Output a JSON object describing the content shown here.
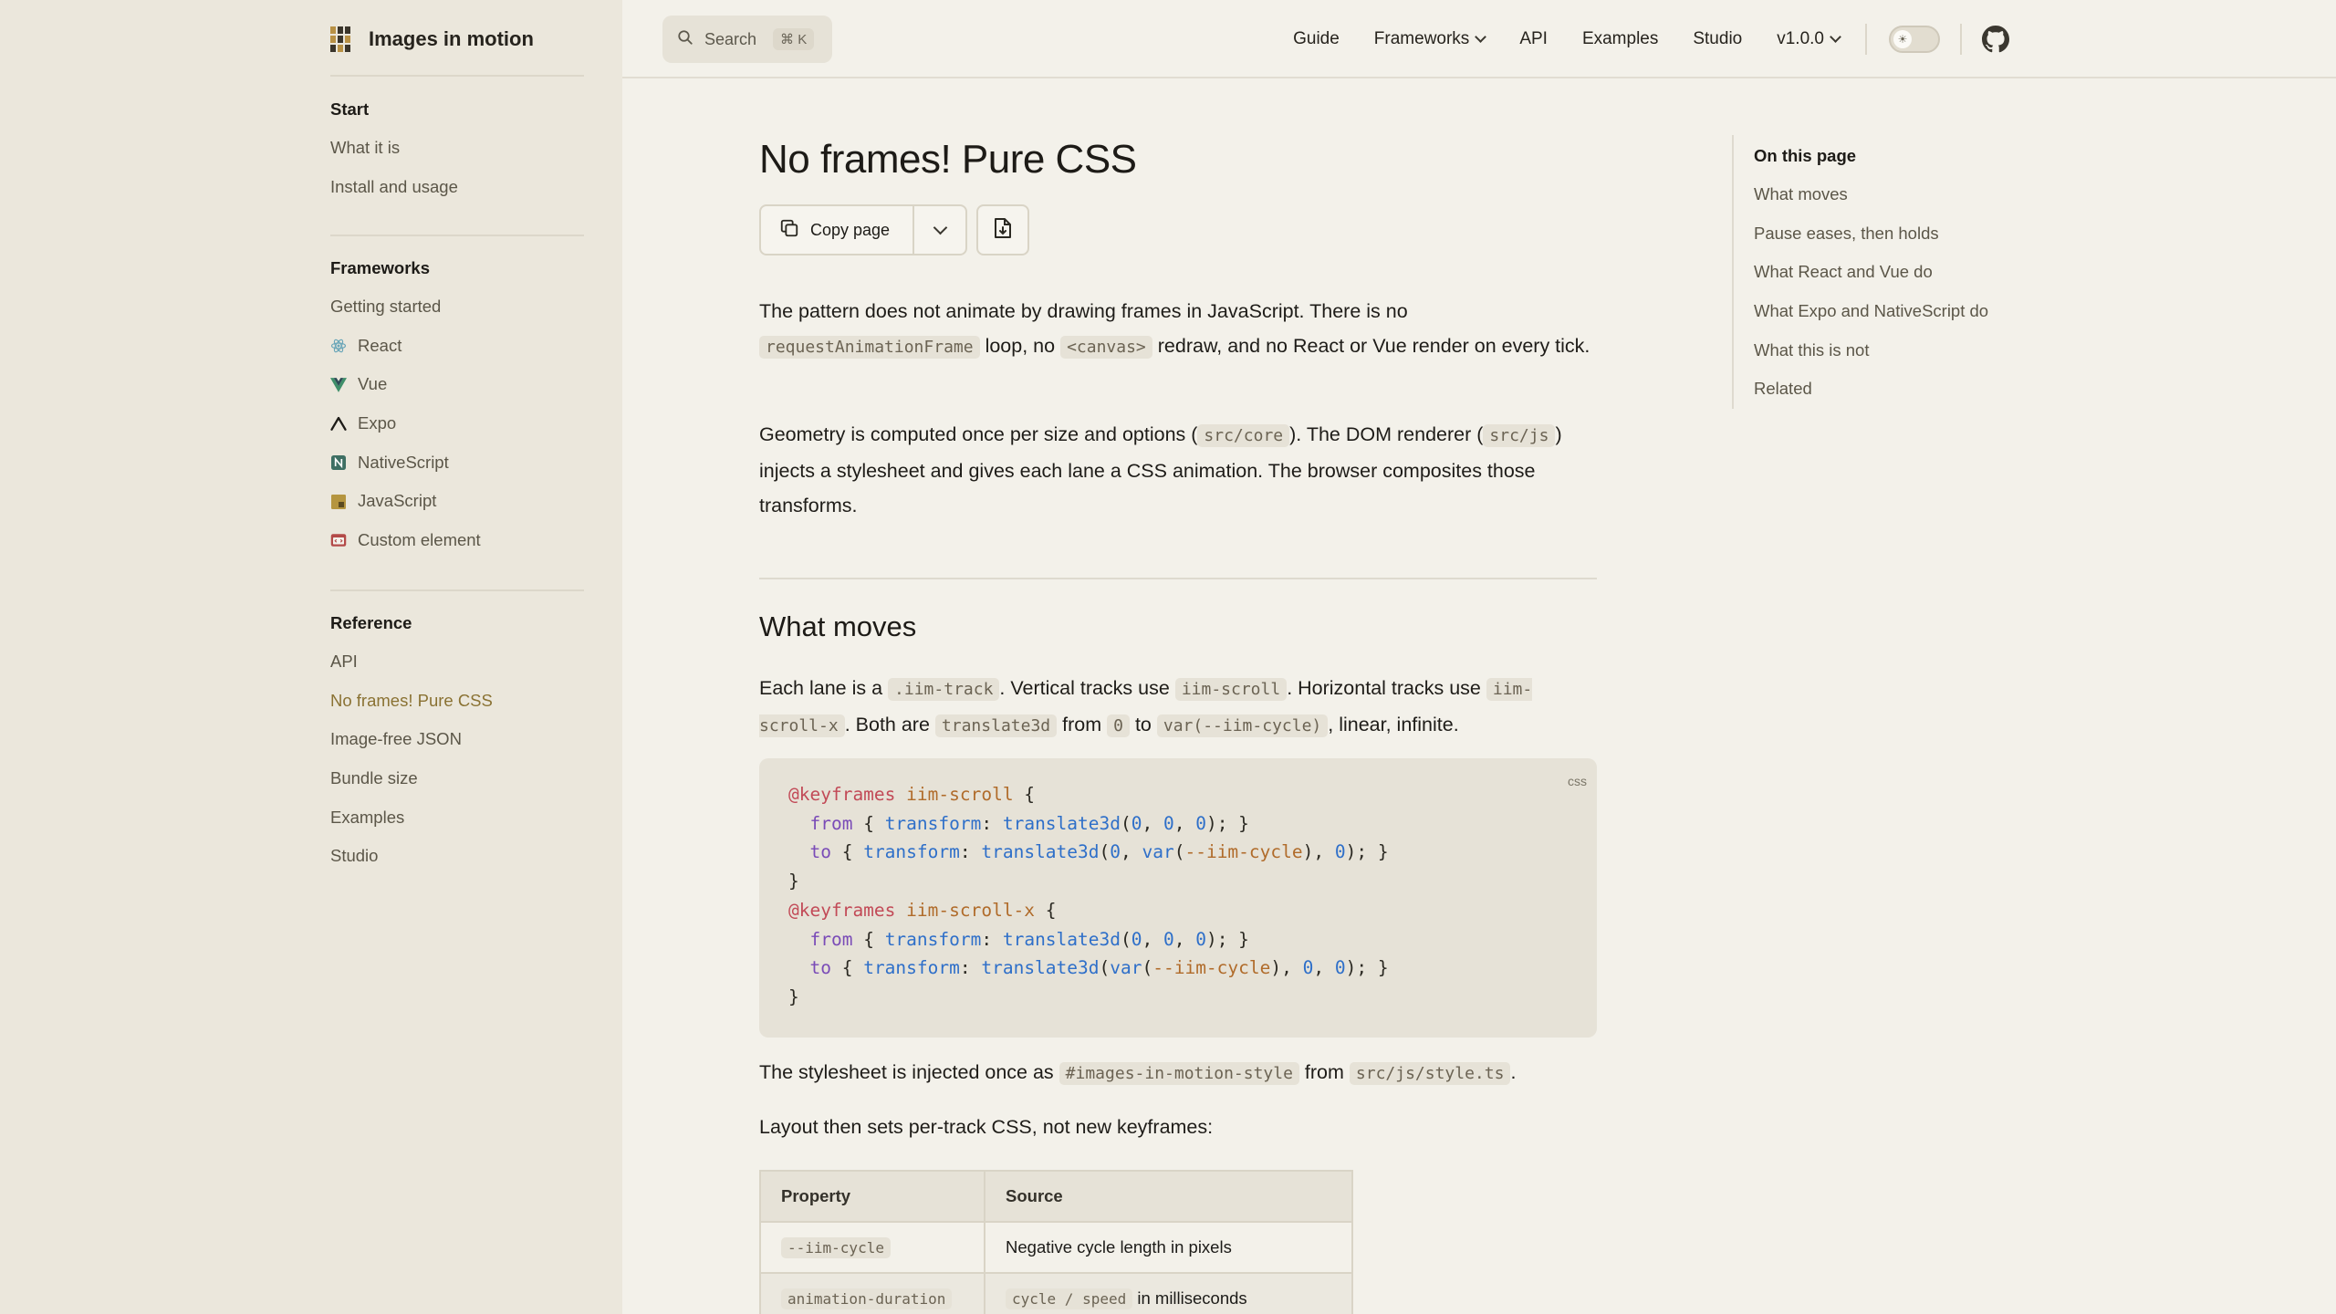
{
  "brand": {
    "title": "Images in motion"
  },
  "search": {
    "label": "Search",
    "shortcut": "⌘ K"
  },
  "nav": {
    "items": [
      "Guide",
      "Frameworks",
      "API",
      "Examples",
      "Studio",
      "v1.0.0"
    ]
  },
  "sidebar": {
    "start": {
      "heading": "Start",
      "items": [
        "What it is",
        "Install and usage"
      ]
    },
    "frameworks": {
      "heading": "Frameworks",
      "items": [
        "Getting started",
        "React",
        "Vue",
        "Expo",
        "NativeScript",
        "JavaScript",
        "Custom element"
      ]
    },
    "reference": {
      "heading": "Reference",
      "items": [
        "API",
        "No frames! Pure CSS",
        "Image-free JSON",
        "Bundle size",
        "Examples",
        "Studio"
      ],
      "active": "No frames! Pure CSS"
    }
  },
  "page": {
    "title": "No frames! Pure CSS",
    "copy_label": "Copy page",
    "p1": {
      "t1": "The pattern does not animate by drawing frames in JavaScript. There is no",
      "c1": "requestAnimationFrame",
      "t2": "loop, no",
      "c2": "<canvas>",
      "t3": "redraw, and no React or Vue render on every tick."
    },
    "p2": {
      "t1": "Geometry is computed once per size and options (",
      "c1": "src/core",
      "t2": "). The DOM renderer (",
      "c2": "src/js",
      "t3": ") injects a stylesheet and gives each lane a CSS animation. The browser composites those transforms."
    },
    "h2": "What moves",
    "p3": {
      "t1": "Each lane is a",
      "c1": ".iim-track",
      "t2": ". Vertical tracks use",
      "c2": "iim-scroll",
      "t3": ". Horizontal tracks use",
      "c3": "iim-scroll-x",
      "t4": ". Both are",
      "c4": "translate3d",
      "t5": "from",
      "c5": "0",
      "t6": "to",
      "c6": "var(--iim-cycle)",
      "t7": ", linear, infinite."
    },
    "code_lang": "css",
    "p4": {
      "t1": "The stylesheet is injected once as",
      "c1": "#images-in-motion-style",
      "t2": "from",
      "c2": "src/js/style.ts",
      "t3": "."
    },
    "p5": "Layout then sets per-track CSS, not new keyframes:",
    "table": {
      "headers": [
        "Property",
        "Source"
      ],
      "rows": [
        {
          "property": "--iim-cycle",
          "source_code": "",
          "source": "Negative cycle length in pixels"
        },
        {
          "property": "animation-duration",
          "source_code": "cycle / speed",
          "source": "in milliseconds"
        }
      ]
    }
  },
  "toc": {
    "heading": "On this page",
    "items": [
      "What moves",
      "Pause eases, then holds",
      "What React and Vue do",
      "What Expo and NativeScript do",
      "What this is not",
      "Related"
    ]
  }
}
